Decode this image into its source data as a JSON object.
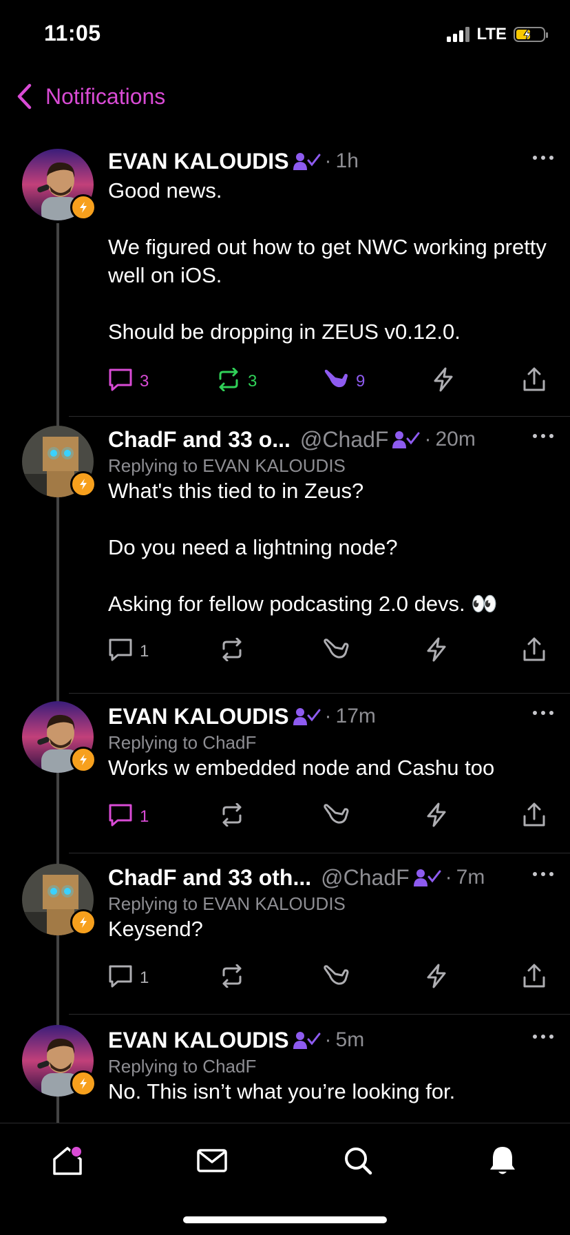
{
  "status": {
    "time": "11:05",
    "network": "LTE"
  },
  "nav": {
    "title": "Notifications"
  },
  "colors": {
    "accent": "#d94bd5",
    "repost": "#30d158",
    "like": "#8e5bf0",
    "zap": "#f7a01d",
    "muted": "#8e8e93"
  },
  "posts": [
    {
      "name": "EVAN KALOUDIS",
      "handle": "",
      "time": "1h",
      "reply_to": "",
      "text": "Good news.\n\nWe figured out how to get NWC working pretty well on iOS.\n\nShould be dropping in ZEUS v0.12.0.",
      "replies": "3",
      "reposts": "3",
      "likes": "9"
    },
    {
      "name": "ChadF and 33 o...",
      "handle": "@ChadF",
      "time": "20m",
      "reply_to": "Replying to EVAN KALOUDIS",
      "text": "What's this tied to in Zeus?\n\nDo you need a lightning node?\n\nAsking for fellow podcasting 2.0 devs. 👀",
      "replies": "1",
      "reposts": "",
      "likes": ""
    },
    {
      "name": "EVAN KALOUDIS",
      "handle": "",
      "time": "17m",
      "reply_to": "Replying to ChadF",
      "text": "Works w embedded node and Cashu too",
      "replies": "1",
      "reposts": "",
      "likes": ""
    },
    {
      "name": "ChadF and 33 oth...",
      "handle": "@ChadF",
      "time": "7m",
      "reply_to": "Replying to EVAN KALOUDIS",
      "text": "Keysend?",
      "replies": "1",
      "reposts": "",
      "likes": ""
    },
    {
      "name": "EVAN KALOUDIS",
      "handle": "",
      "time": "5m",
      "reply_to": "Replying to ChadF",
      "text": "No. This isn’t what you’re looking for.",
      "replies": "",
      "reposts": "",
      "likes": ""
    }
  ],
  "tabs": [
    "home-icon",
    "mail-icon",
    "search-icon",
    "bell-icon"
  ]
}
